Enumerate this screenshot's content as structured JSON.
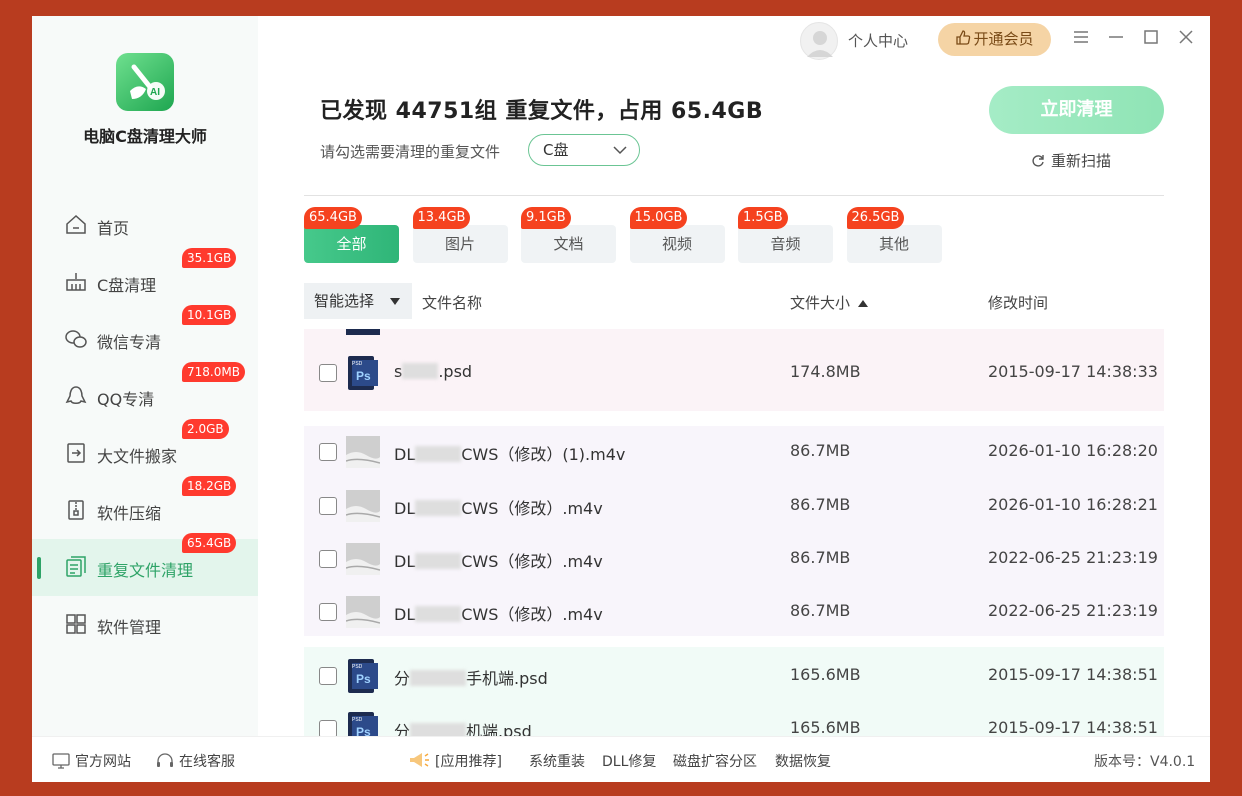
{
  "app": {
    "name": "电脑C盘清理大师"
  },
  "titlebar": {
    "user_center": "个人中心",
    "vip_button": "开通会员"
  },
  "sidebar": {
    "items": [
      {
        "label": "首页",
        "badge": "",
        "icon": "home-icon",
        "active": false
      },
      {
        "label": "C盘清理",
        "badge": "35.1GB",
        "icon": "broom-icon",
        "active": false
      },
      {
        "label": "微信专清",
        "badge": "10.1GB",
        "icon": "wechat-icon",
        "active": false
      },
      {
        "label": "QQ专清",
        "badge": "718.0MB",
        "icon": "qq-icon",
        "active": false
      },
      {
        "label": "大文件搬家",
        "badge": "2.0GB",
        "icon": "move-file-icon",
        "active": false
      },
      {
        "label": "软件压缩",
        "badge": "18.2GB",
        "icon": "zip-icon",
        "active": false
      },
      {
        "label": "重复文件清理",
        "badge": "65.4GB",
        "icon": "duplicate-file-icon",
        "active": true
      },
      {
        "label": "软件管理",
        "badge": "",
        "icon": "apps-icon",
        "active": false
      }
    ]
  },
  "header": {
    "headline": "已发现 44751组 重复文件，占用 65.4GB",
    "subline": "请勾选需要清理的重复文件",
    "drive": "C盘",
    "clean_button": "立即清理",
    "rescan": "重新扫描"
  },
  "categories": [
    {
      "label": "全部",
      "size": "65.4GB",
      "active": true
    },
    {
      "label": "图片",
      "size": "13.4GB",
      "active": false
    },
    {
      "label": "文档",
      "size": "9.1GB",
      "active": false
    },
    {
      "label": "视频",
      "size": "15.0GB",
      "active": false
    },
    {
      "label": "音频",
      "size": "1.5GB",
      "active": false
    },
    {
      "label": "其他",
      "size": "26.5GB",
      "active": false
    }
  ],
  "table": {
    "smart_select": "智能选择",
    "col_name": "文件名称",
    "col_size": "文件大小",
    "col_time": "修改时间",
    "rows": [
      {
        "name_prefix": "s",
        "name_suffix": ".psd",
        "size": "174.8MB",
        "time": "2015-09-17 14:38:33",
        "type": "psd"
      },
      {
        "name_prefix": "DL",
        "name_suffix": "CWS（修改）(1).m4v",
        "size": "86.7MB",
        "time": "2026-01-10 16:28:20",
        "type": "video"
      },
      {
        "name_prefix": "DL",
        "name_suffix": "CWS（修改）.m4v",
        "size": "86.7MB",
        "time": "2026-01-10 16:28:21",
        "type": "video"
      },
      {
        "name_prefix": "DL",
        "name_suffix": "CWS（修改）.m4v",
        "size": "86.7MB",
        "time": "2022-06-25 21:23:19",
        "type": "video"
      },
      {
        "name_prefix": "DL",
        "name_suffix": "CWS（修改）.m4v",
        "size": "86.7MB",
        "time": "2022-06-25 21:23:19",
        "type": "video"
      },
      {
        "name_prefix": "分",
        "name_suffix": "手机端.psd",
        "size": "165.6MB",
        "time": "2015-09-17 14:38:51",
        "type": "psd"
      },
      {
        "name_prefix": "分",
        "name_suffix": "机端.psd",
        "size": "165.6MB",
        "time": "2015-09-17 14:38:51",
        "type": "psd"
      }
    ]
  },
  "footer": {
    "website": "官方网站",
    "support": "在线客服",
    "recommend": "[应用推荐]",
    "links": [
      "系统重装",
      "DLL修复",
      "磁盘扩容分区",
      "数据恢复"
    ],
    "version": "版本号：V4.0.1"
  },
  "colors": {
    "accent": "#2ea367",
    "badge": "#ff3a2e",
    "vip": "#f5d4a5",
    "frame": "#b83c1f"
  }
}
